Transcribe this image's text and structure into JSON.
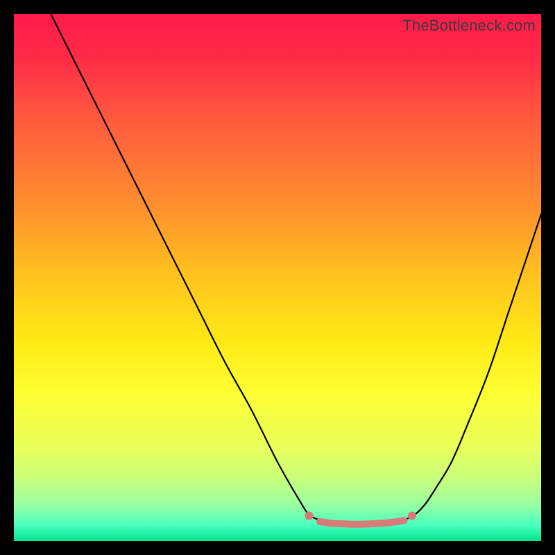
{
  "watermark": "TheBottleneck.com",
  "chart_data": {
    "type": "line",
    "title": "",
    "xlabel": "",
    "ylabel": "",
    "xlim": [
      0,
      100
    ],
    "ylim": [
      0,
      100
    ],
    "gradient_stops": [
      {
        "offset": 0.0,
        "color": "#ff1a4b"
      },
      {
        "offset": 0.08,
        "color": "#ff2a47"
      },
      {
        "offset": 0.2,
        "color": "#ff5a3e"
      },
      {
        "offset": 0.35,
        "color": "#ff8a30"
      },
      {
        "offset": 0.5,
        "color": "#ffc41e"
      },
      {
        "offset": 0.62,
        "color": "#ffe915"
      },
      {
        "offset": 0.72,
        "color": "#fdff33"
      },
      {
        "offset": 0.82,
        "color": "#eaff59"
      },
      {
        "offset": 0.88,
        "color": "#c9ff7a"
      },
      {
        "offset": 0.93,
        "color": "#9bffa0"
      },
      {
        "offset": 0.97,
        "color": "#4affc0"
      },
      {
        "offset": 1.0,
        "color": "#00e58b"
      }
    ],
    "series": [
      {
        "name": "left-curve",
        "x": [
          7,
          10,
          15,
          20,
          25,
          30,
          35,
          40,
          45,
          50,
          54,
          56,
          58
        ],
        "y": [
          100,
          94,
          84,
          74,
          64,
          54,
          44,
          34,
          25,
          15,
          8,
          5,
          4
        ]
      },
      {
        "name": "right-curve",
        "x": [
          74,
          76,
          78,
          80,
          83,
          86,
          90,
          94,
          98,
          100
        ],
        "y": [
          4,
          5,
          7,
          10,
          15,
          22,
          32,
          44,
          56,
          62
        ]
      }
    ],
    "flat_segment": {
      "x": [
        58,
        60,
        62,
        64,
        66,
        68,
        70,
        72,
        74
      ],
      "y": [
        3.7,
        3.4,
        3.3,
        3.2,
        3.2,
        3.3,
        3.4,
        3.6,
        3.9
      ],
      "color": "#d77a78",
      "width": 10
    },
    "markers": [
      {
        "x": 56,
        "y": 4.8,
        "r": 6,
        "color": "#d77a78"
      },
      {
        "x": 75.5,
        "y": 4.8,
        "r": 6,
        "color": "#d77a78"
      }
    ]
  }
}
